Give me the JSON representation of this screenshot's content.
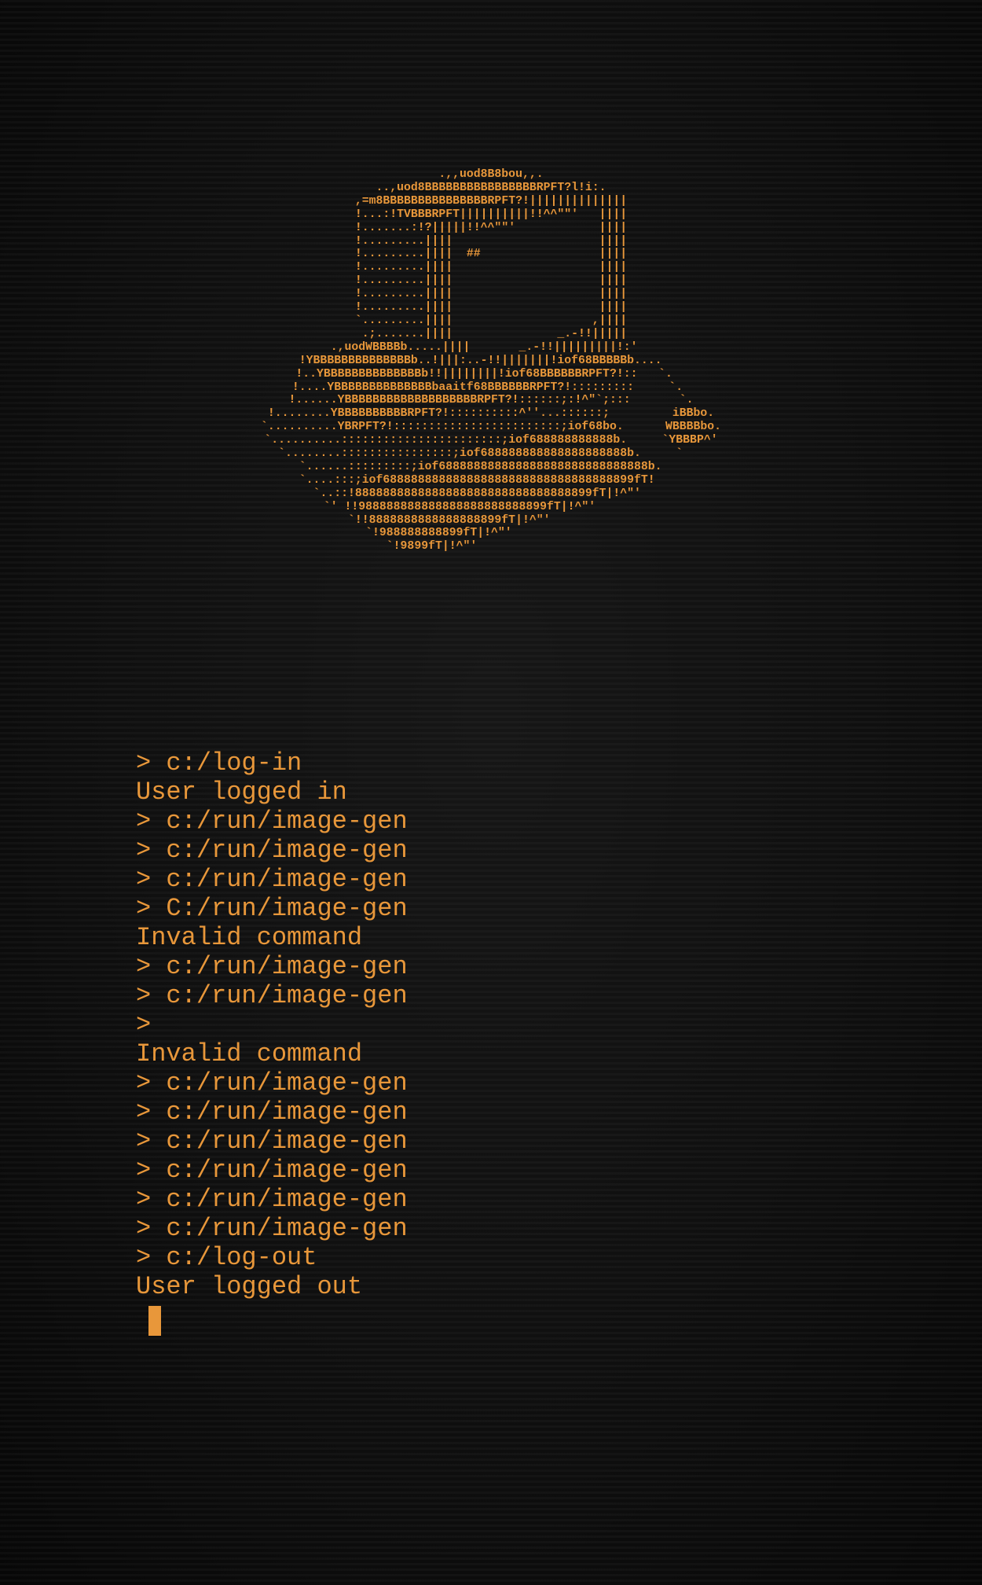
{
  "ascii_art": "          .,,uod8B8bou,,.          \n      ..,uod8BBBBBBBBBBBBBBBBRPFT?l!i:.      \n   ,=m8BBBBBBBBBBBBBBBRPFT?!||||||||||||||   \n   !...:!TVBBBRPFT||||||||||!!^^\"\"'   ||||   \n   !.......:!?|||||!!^^\"\"'            ||||   \n   !.........||||                     ||||   \n   !.........||||  ##                 ||||   \n   !.........||||                     ||||   \n   !.........||||                     ||||   \n   !.........||||                     ||||   \n   !.........||||                     ||||   \n   `.........||||                    ,||||   \n    .;.......||||               _.-!!|||||   \n .,uodWBBBBb.....||||       _.-!!|||||||||!:'   \n!YBBBBBBBBBBBBBBb..!|||:..-!!|||||||!iof68BBBBBb....   \n!..YBBBBBBBBBBBBBBb!!||||||||!iof68BBBBBBRPFT?!::   `.  \n!....YBBBBBBBBBBBBBBbaaitf68BBBBBBRPFT?!:::::::::     `. \n!......YBBBBBBBBBBBBBBBBBBBRPFT?!::::::;:!^\"`;:::       `.\n!........YBBBBBBBBBBRPFT?!::::::::::^''...::::::;         iBBbo.\n`..........YBRPFT?!::::::::::::::::::::::::;iof68bo.      WBBBBbo.\n`..........:::::::::::::::::::::::;iof688888888888b.     `YBBBP^'\n`........::::::::::::::::;iof688888888888888888888b.     `   \n`......:::::::::;iof688888888888888888888888888888b.   \n`....:::;iof688888888888888888888888888888888899fT!    \n`..::!8888888888888888888888888888888899fT|!^\"'    \n`' !!988888888888888888888888899fT|!^\"'         \n`!!8888888888888888899fT|!^\"'            \n`!988888888899fT|!^\"'               \n`!9899fT|!^\"'                 ",
  "terminal": {
    "lines": [
      "> c:/log-in",
      "User logged in",
      "> c:/run/image-gen",
      "> c:/run/image-gen",
      "> c:/run/image-gen",
      "> C:/run/image-gen",
      "Invalid command",
      "> c:/run/image-gen",
      "> c:/run/image-gen",
      ">",
      "Invalid command",
      "> c:/run/image-gen",
      "> c:/run/image-gen",
      "> c:/run/image-gen",
      "> c:/run/image-gen",
      "> c:/run/image-gen",
      "> c:/run/image-gen",
      "> c:/log-out",
      "User logged out"
    ]
  },
  "colors": {
    "text": "#e8973a",
    "background": "#0c0c0c"
  }
}
